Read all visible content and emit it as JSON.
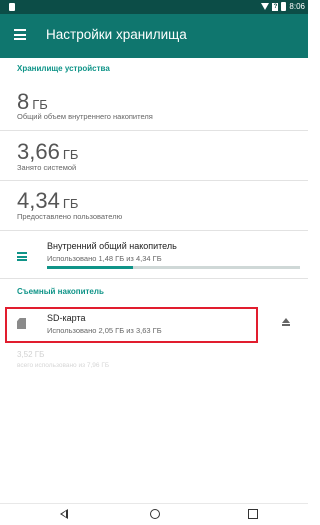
{
  "status_bar": {
    "time": "8:06"
  },
  "app_bar": {
    "title": "Настройки хранилища"
  },
  "device_storage": {
    "header": "Хранилище устройства",
    "total": {
      "value": "8",
      "unit": "ГБ",
      "label": "Общий объем внутреннего накопителя"
    },
    "system": {
      "value": "3,66",
      "unit": "ГБ",
      "label": "Занято системой"
    },
    "user": {
      "value": "4,34",
      "unit": "ГБ",
      "label": "Предоставлено пользователю"
    },
    "internal": {
      "title": "Внутренний общий накопитель",
      "subtitle": "Использовано 1,48 ГБ из 4,34 ГБ",
      "progress": 0.34
    }
  },
  "removable": {
    "header": "Съемный накопитель",
    "sd": {
      "title": "SD-карта",
      "subtitle": "Использовано 2,05 ГБ из 3,63 ГБ"
    },
    "faded_value": "3,52 ГБ",
    "faded_label": "всего использовано из 7,96 ГБ"
  },
  "icons": {
    "menu": "menu-icon",
    "internal": "storage-list-icon",
    "sd": "sd-card-icon",
    "eject": "eject-icon"
  },
  "colors": {
    "status_bar": "#0c4d47",
    "app_bar": "#0f766e",
    "accent": "#0f9488",
    "highlight": "#e11d2e"
  }
}
